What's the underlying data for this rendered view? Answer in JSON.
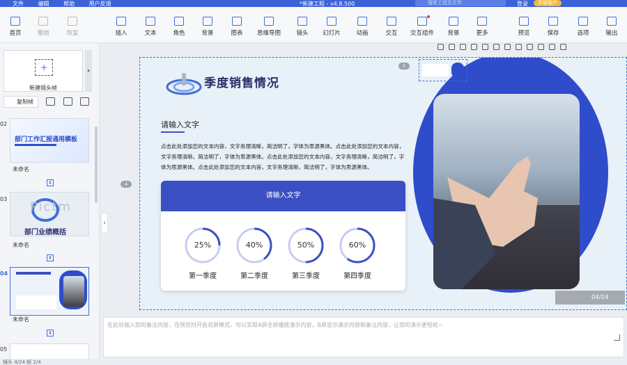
{
  "titlebar": {
    "menu": [
      "文件",
      "编辑",
      "帮助",
      "用户反馈"
    ],
    "doc_title": "*新建工程 - v4.8.500",
    "search_placeholder": "搜索工程及文件",
    "login": "登录",
    "upgrade": "开级账户"
  },
  "toolbar": {
    "items": [
      {
        "label": "首页",
        "x": 0,
        "icon": "home-icon"
      },
      {
        "label": "撤销",
        "x": 0,
        "icon": "undo-icon"
      },
      {
        "label": "恢复",
        "x": 0,
        "icon": "redo-icon"
      },
      {
        "label": "插入",
        "x": 0,
        "icon": "plus-icon"
      },
      {
        "label": "文本",
        "x": 0,
        "icon": "text-icon"
      },
      {
        "label": "角色",
        "x": 0,
        "icon": "person-icon"
      },
      {
        "label": "背景",
        "x": 0,
        "icon": "background-icon"
      },
      {
        "label": "图表",
        "x": 0,
        "icon": "chart-icon"
      },
      {
        "label": "思维导图",
        "x": 0,
        "icon": "mindmap-icon"
      },
      {
        "label": "镜头",
        "x": 0,
        "icon": "camera-lens-icon"
      },
      {
        "label": "幻灯片",
        "x": 0,
        "icon": "slide-icon"
      },
      {
        "label": "动画",
        "x": 0,
        "icon": "animation-icon"
      },
      {
        "label": "交互",
        "x": 0,
        "icon": "interaction-icon"
      },
      {
        "label": "交互组件",
        "x": 0,
        "icon": "component-icon"
      },
      {
        "label": "背景",
        "x": 0,
        "icon": "background-icon"
      },
      {
        "label": "更多",
        "x": 0,
        "icon": "more-icon"
      },
      {
        "label": "预览",
        "x": 0,
        "icon": "preview-icon"
      },
      {
        "label": "保存",
        "x": 0,
        "icon": "save-icon"
      },
      {
        "label": "选项",
        "x": 0,
        "icon": "gear-icon"
      },
      {
        "label": "输出",
        "x": 0,
        "icon": "export-icon"
      }
    ]
  },
  "left": {
    "new_frame": "新建镜头帧",
    "copy_frame": "复制帧",
    "slides": [
      {
        "num": "02",
        "name": "未命名",
        "title": "部门工作汇报通用模板"
      },
      {
        "num": "03",
        "name": "未命名",
        "title": "部门业绩概括",
        "watermark": "Pictm"
      },
      {
        "num": "04",
        "name": "未命名",
        "title": ""
      },
      {
        "num": "05",
        "name": "",
        "title": ""
      }
    ],
    "status": "镜头 4/24   帧 2/4"
  },
  "slide": {
    "title": "季度销售情况",
    "subtitle": "请输入文字",
    "body": "点击此处添加您的文本内容，文字务理清晰，简洁明了，字体为思源黑体。点击此处添加您的文本内容，文字务理清晰，简洁明了，字体为思源黑体。点击此处添加您的文本内容，文字务理清晰，简洁明了，字体为思源黑体。点击此处添加您的文本内容，文字务理清晰，简洁明了，字体为思源黑体。",
    "card_title": "请输入文字",
    "rings": [
      {
        "label": "25%",
        "quarter": "第一季度"
      },
      {
        "label": "40%",
        "quarter": "第二季度"
      },
      {
        "label": "50%",
        "quarter": "第三季度"
      },
      {
        "label": "60%",
        "quarter": "第四季度"
      }
    ],
    "index_left": "4",
    "index_right": "5",
    "page": "04/24"
  },
  "notes_placeholder": "在此处输入您的备注内容，在预览时开启双屏模式，可以实现A屏全屏播放演示内容，B屏显示演示内容和备注内容，让您的演示更轻松~",
  "colors": {
    "accent": "#3b62d8",
    "brand_dark": "#2f4ccb",
    "card_header": "#3b4fc5"
  }
}
